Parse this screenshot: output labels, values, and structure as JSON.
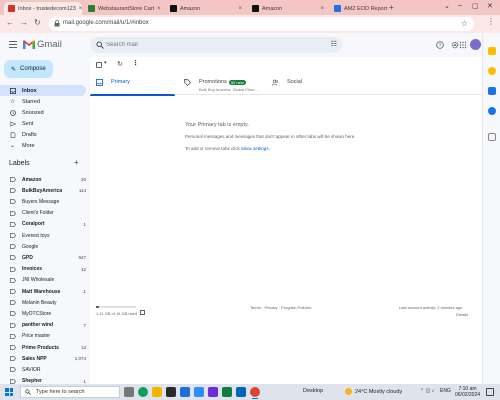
{
  "browser": {
    "tabs": [
      {
        "title": "Inbox - trustedecom123",
        "active": true,
        "favicon": "gmail-favicon",
        "color": "#d93025"
      },
      {
        "title": "WebstaurantStore Cart",
        "active": false,
        "favicon": "webstaurant-favicon",
        "color": "#2e7d32"
      },
      {
        "title": "Amazon",
        "active": false,
        "favicon": "amazon-favicon",
        "color": "#111111"
      },
      {
        "title": "Amazon",
        "active": false,
        "favicon": "amazon-favicon",
        "color": "#111111"
      },
      {
        "title": "AMZ EOD Report",
        "active": false,
        "favicon": "report-favicon",
        "color": "#1a73e8"
      }
    ],
    "url": "mail.google.com/mail/u/1/#inbox",
    "chrome_color": "#f3c6c4"
  },
  "gmail": {
    "logo_text": "Gmail",
    "search_placeholder": "Search mail",
    "compose_label": "Compose",
    "nav": [
      {
        "label": "Inbox",
        "selected": true,
        "icon": "inbox-icon"
      },
      {
        "label": "Starred",
        "selected": false,
        "icon": "star-icon"
      },
      {
        "label": "Snoozed",
        "selected": false,
        "icon": "clock-icon"
      },
      {
        "label": "Sent",
        "selected": false,
        "icon": "send-icon"
      },
      {
        "label": "Drafts",
        "selected": false,
        "icon": "draft-icon"
      },
      {
        "label": "More",
        "selected": false,
        "icon": "chevron-down-icon"
      }
    ],
    "labels_heading": "Labels",
    "labels": [
      {
        "name": "Amazon",
        "count": "20",
        "bold": true
      },
      {
        "name": "BulkBuyAmerica",
        "count": "114",
        "bold": true
      },
      {
        "name": "Buyers Message",
        "count": "",
        "bold": false
      },
      {
        "name": "Client's Folder",
        "count": "",
        "bold": false
      },
      {
        "name": "Coralport",
        "count": "1",
        "bold": true
      },
      {
        "name": "Everest toys",
        "count": "",
        "bold": false
      },
      {
        "name": "Google",
        "count": "",
        "bold": false
      },
      {
        "name": "GPD",
        "count": "947",
        "bold": true
      },
      {
        "name": "Invoices",
        "count": "12",
        "bold": true
      },
      {
        "name": "JNI Wholesale",
        "count": "",
        "bold": false
      },
      {
        "name": "Matt Warehouse",
        "count": "1",
        "bold": true
      },
      {
        "name": "Melanin Beauty",
        "count": "",
        "bold": false
      },
      {
        "name": "MyOTCStore",
        "count": "",
        "bold": false
      },
      {
        "name": "panther wind",
        "count": "7",
        "bold": true
      },
      {
        "name": "Price master",
        "count": "",
        "bold": false
      },
      {
        "name": "Prime Products",
        "count": "13",
        "bold": true
      },
      {
        "name": "Sales NPP",
        "count": "1,074",
        "bold": true
      },
      {
        "name": "SAVIOR",
        "count": "",
        "bold": false
      },
      {
        "name": "Shepher",
        "count": "1",
        "bold": true
      }
    ],
    "inbox_tabs": {
      "primary": "Primary",
      "promotions": "Promotions",
      "promotions_badge": "50 new",
      "promotions_sub": "Bulk Buy America, Global Price...",
      "social": "Social"
    },
    "empty": {
      "title": "Your Primary tab is empty.",
      "line2": "Personal messages and messages that don't appear in other tabs will be shown here.",
      "line3_prefix": "To add or remove tabs click",
      "line3_link": "inbox settings",
      "line3_suffix": "."
    },
    "footer": {
      "storage": "1.11 GB of 15 GB used",
      "storage_fraction": 0.074,
      "links": "Terms · Privacy · Program Policies",
      "activity": "Last account activity: 2 minutes ago",
      "details": "Details"
    }
  },
  "taskbar": {
    "search_placeholder": "Type here to search",
    "desktop": "Desktop",
    "weather": "24°C  Mostly cloudy",
    "lang": "ENG",
    "time": "7:10 am",
    "date": "06/02/2024"
  }
}
